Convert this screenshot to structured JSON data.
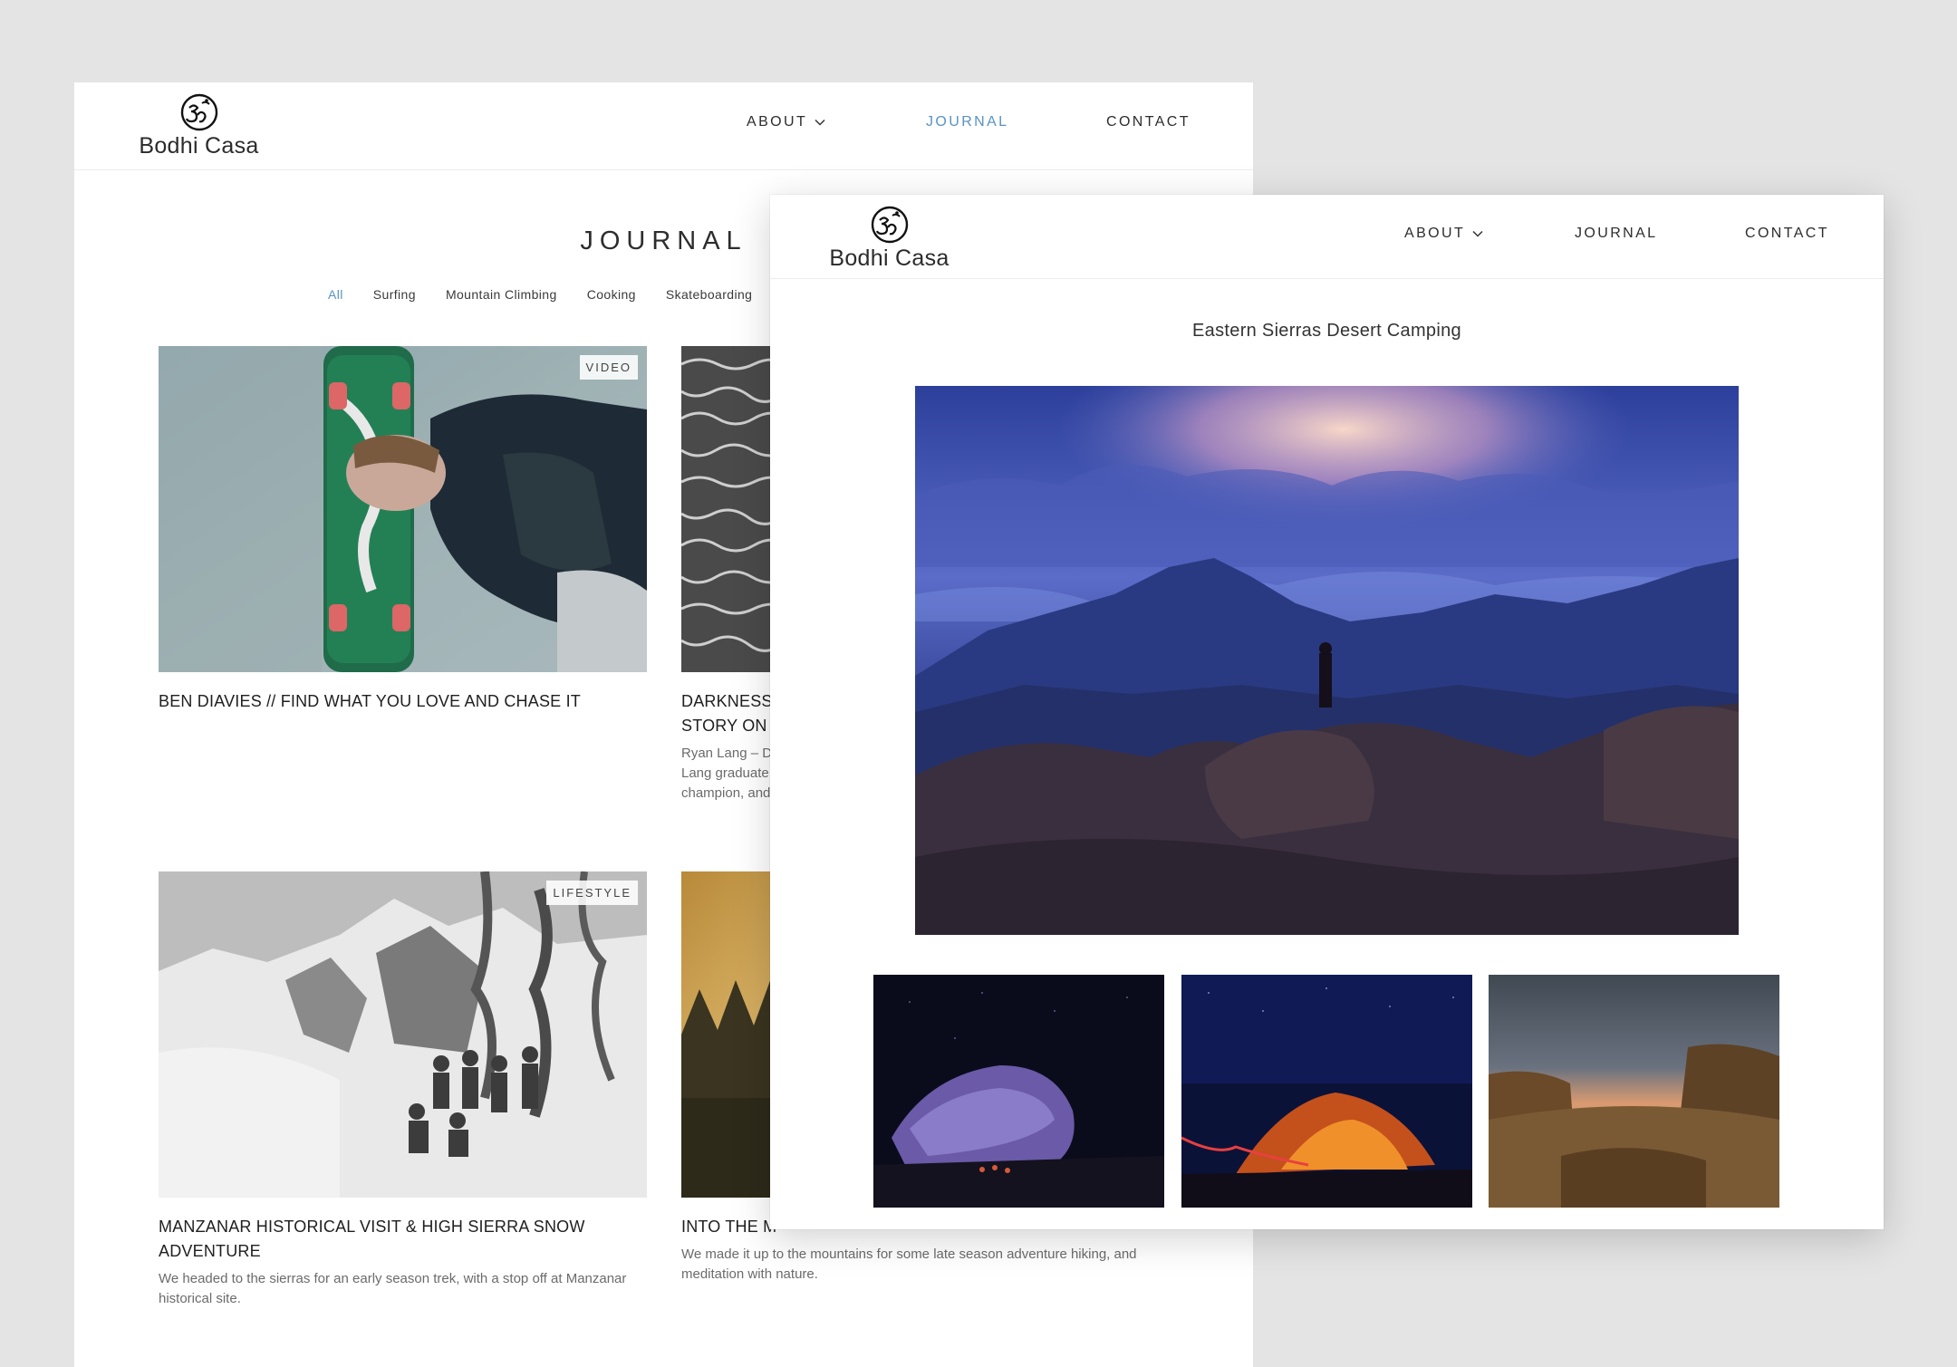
{
  "back_window": {
    "logo": {
      "brand": "Bodhi Casa"
    },
    "nav": {
      "about": "ABOUT",
      "journal": "JOURNAL",
      "contact": "CONTACT"
    },
    "page_title": "JOURNAL",
    "filters": [
      "All",
      "Surfing",
      "Mountain Climbing",
      "Cooking",
      "Skateboarding"
    ],
    "active_filter": "All",
    "posts": [
      {
        "badge": "VIDEO",
        "title": "BEN DIAVIES // FIND WHAT YOU LOVE AND CHASE IT",
        "excerpt": ""
      },
      {
        "badge": "",
        "title_line1": "DARKNESS B",
        "title_line2": "STORY ON V",
        "excerpt_line1": "Ryan Lang – D",
        "excerpt_line2": "Lang graduate",
        "excerpt_line3": "champion, and"
      },
      {
        "badge": "LIFESTYLE",
        "title": "MANZANAR HISTORICAL VISIT & HIGH SIERRA SNOW ADVENTURE",
        "excerpt": "We headed to the sierras for an early season trek, with a stop off at Manzanar historical site."
      },
      {
        "badge": "",
        "title": "INTO THE M",
        "excerpt": "We made it up to the mountains for some late season adventure hiking, and meditation with nature."
      }
    ]
  },
  "front_window": {
    "logo": {
      "brand": "Bodhi Casa"
    },
    "nav": {
      "about": "ABOUT",
      "journal": "JOURNAL",
      "contact": "CONTACT"
    },
    "post_title": "Eastern Sierras Desert Camping"
  },
  "colors": {
    "accent": "#5a93c0",
    "background": "#e4e4e4",
    "text": "#2d2d2d"
  },
  "icons": {
    "logo": "om-symbol-icon",
    "dropdown": "chevron-down-icon"
  }
}
